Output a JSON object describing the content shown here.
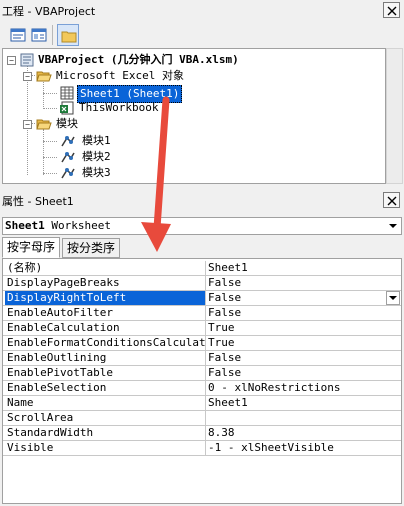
{
  "project_pane": {
    "title": "工程 - VBAProject",
    "tree": {
      "root": "VBAProject (几分钟入门 VBA.xlsm)",
      "excel_objects_folder": "Microsoft Excel 对象",
      "sheet1": "Sheet1 (Sheet1)",
      "this_workbook": "ThisWorkbook",
      "modules_folder": "模块",
      "modules": [
        "模块1",
        "模块2",
        "模块3"
      ]
    }
  },
  "properties_pane": {
    "title": "属性 - Sheet1",
    "object_name": "Sheet1",
    "object_type": "Worksheet",
    "tabs": [
      "按字母序",
      "按分类序"
    ],
    "rows": [
      {
        "name": "(名称)",
        "value": "Sheet1"
      },
      {
        "name": "DisplayPageBreaks",
        "value": "False"
      },
      {
        "name": "DisplayRightToLeft",
        "value": "False"
      },
      {
        "name": "EnableAutoFilter",
        "value": "False"
      },
      {
        "name": "EnableCalculation",
        "value": "True"
      },
      {
        "name": "EnableFormatConditionsCalculation",
        "value": "True"
      },
      {
        "name": "EnableOutlining",
        "value": "False"
      },
      {
        "name": "EnablePivotTable",
        "value": "False"
      },
      {
        "name": "EnableSelection",
        "value": "0 - xlNoRestrictions"
      },
      {
        "name": "Name",
        "value": "Sheet1"
      },
      {
        "name": "ScrollArea",
        "value": ""
      },
      {
        "name": "StandardWidth",
        "value": "8.38"
      },
      {
        "name": "Visible",
        "value": "-1 - xlSheetVisible"
      }
    ]
  },
  "colors": {
    "selection": "#0a64d8",
    "annotation_arrow": "#e84a3c"
  }
}
